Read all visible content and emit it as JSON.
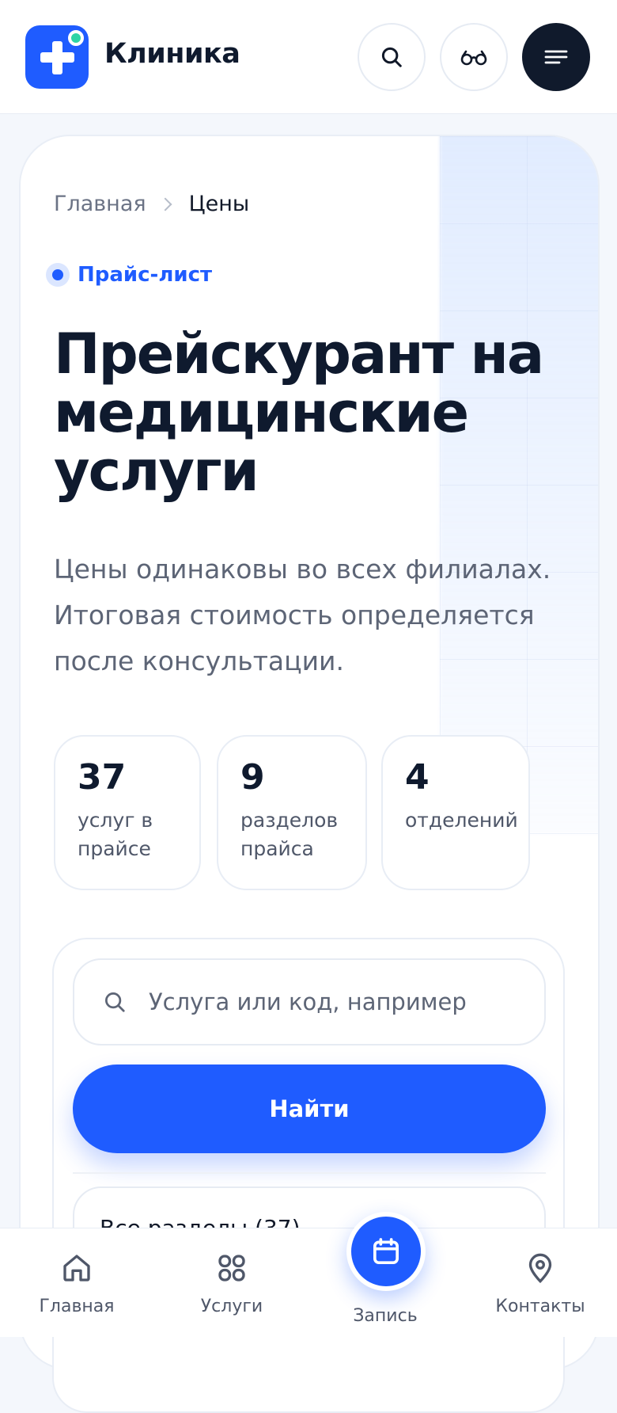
{
  "header": {
    "brand": "Клиника"
  },
  "breadcrumb": {
    "home": "Главная",
    "current": "Цены"
  },
  "hero": {
    "badge": "Прайс-лист",
    "title": "Прейскурант на медицинские услуги",
    "subtitle": "Цены одинаковы во всех филиалах. Итоговая стоимость определяется после консультации."
  },
  "stats": [
    {
      "number": "37",
      "label": "услуг в прайсе"
    },
    {
      "number": "9",
      "label": "разделов прайса"
    },
    {
      "number": "4",
      "label": "отделений"
    }
  ],
  "search": {
    "placeholder": "Услуга или код, например",
    "button": "Найти",
    "category_partial": "Все разделы (37)"
  },
  "nav": {
    "home": "Главная",
    "services": "Услуги",
    "booking": "Запись",
    "contacts": "Контакты"
  },
  "colors": {
    "accent": "#1f5cff",
    "dark": "#101a2c",
    "online_dot": "#2dd4a6"
  }
}
